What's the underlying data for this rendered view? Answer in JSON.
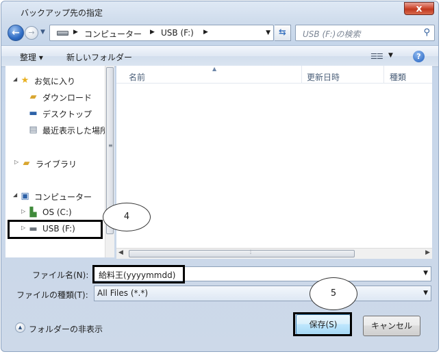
{
  "window": {
    "title": "バックアップ先の指定",
    "close_label": "x"
  },
  "nav": {
    "back_glyph": "←",
    "forward_glyph": "→",
    "path": [
      "コンピューター",
      "USB (F:)"
    ],
    "search_placeholder": "USB (F:)の検索"
  },
  "toolbar": {
    "organize_label": "整理 ▾",
    "new_folder_label": "新しいフォルダー",
    "help_glyph": "?"
  },
  "tree": {
    "items": [
      {
        "label": "お気に入り",
        "icon": "star-icon",
        "expander": "◢"
      },
      {
        "label": "ダウンロード",
        "icon": "download-folder-icon",
        "expander": ""
      },
      {
        "label": "デスクトップ",
        "icon": "desktop-icon",
        "expander": ""
      },
      {
        "label": "最近表示した場所",
        "icon": "recent-places-icon",
        "expander": ""
      },
      {
        "label": "ライブラリ",
        "icon": "library-icon",
        "expander": "▷"
      },
      {
        "label": "コンピューター",
        "icon": "computer-icon",
        "expander": "◢"
      },
      {
        "label": "OS (C:)",
        "icon": "os-drive-icon",
        "expander": "▷"
      },
      {
        "label": "USB (F:)",
        "icon": "usb-drive-icon",
        "expander": "▷"
      }
    ]
  },
  "list": {
    "columns": [
      "名前",
      "更新日時",
      "種類"
    ]
  },
  "form": {
    "filename_label": "ファイル名(N):",
    "filename_value": "給料王(yyyymmdd)",
    "filetype_label": "ファイルの種類(T):",
    "filetype_value": "All Files (*.*)"
  },
  "footer": {
    "hide_folders_label": "フォルダーの非表示",
    "save_label": "保存(S)",
    "cancel_label": "キャンセル"
  },
  "annotations": {
    "callout_4": "4",
    "callout_5": "5"
  },
  "colors": {
    "frame": "#c6d6ea",
    "save_button": "#bee6fd",
    "highlight": "#000000"
  }
}
